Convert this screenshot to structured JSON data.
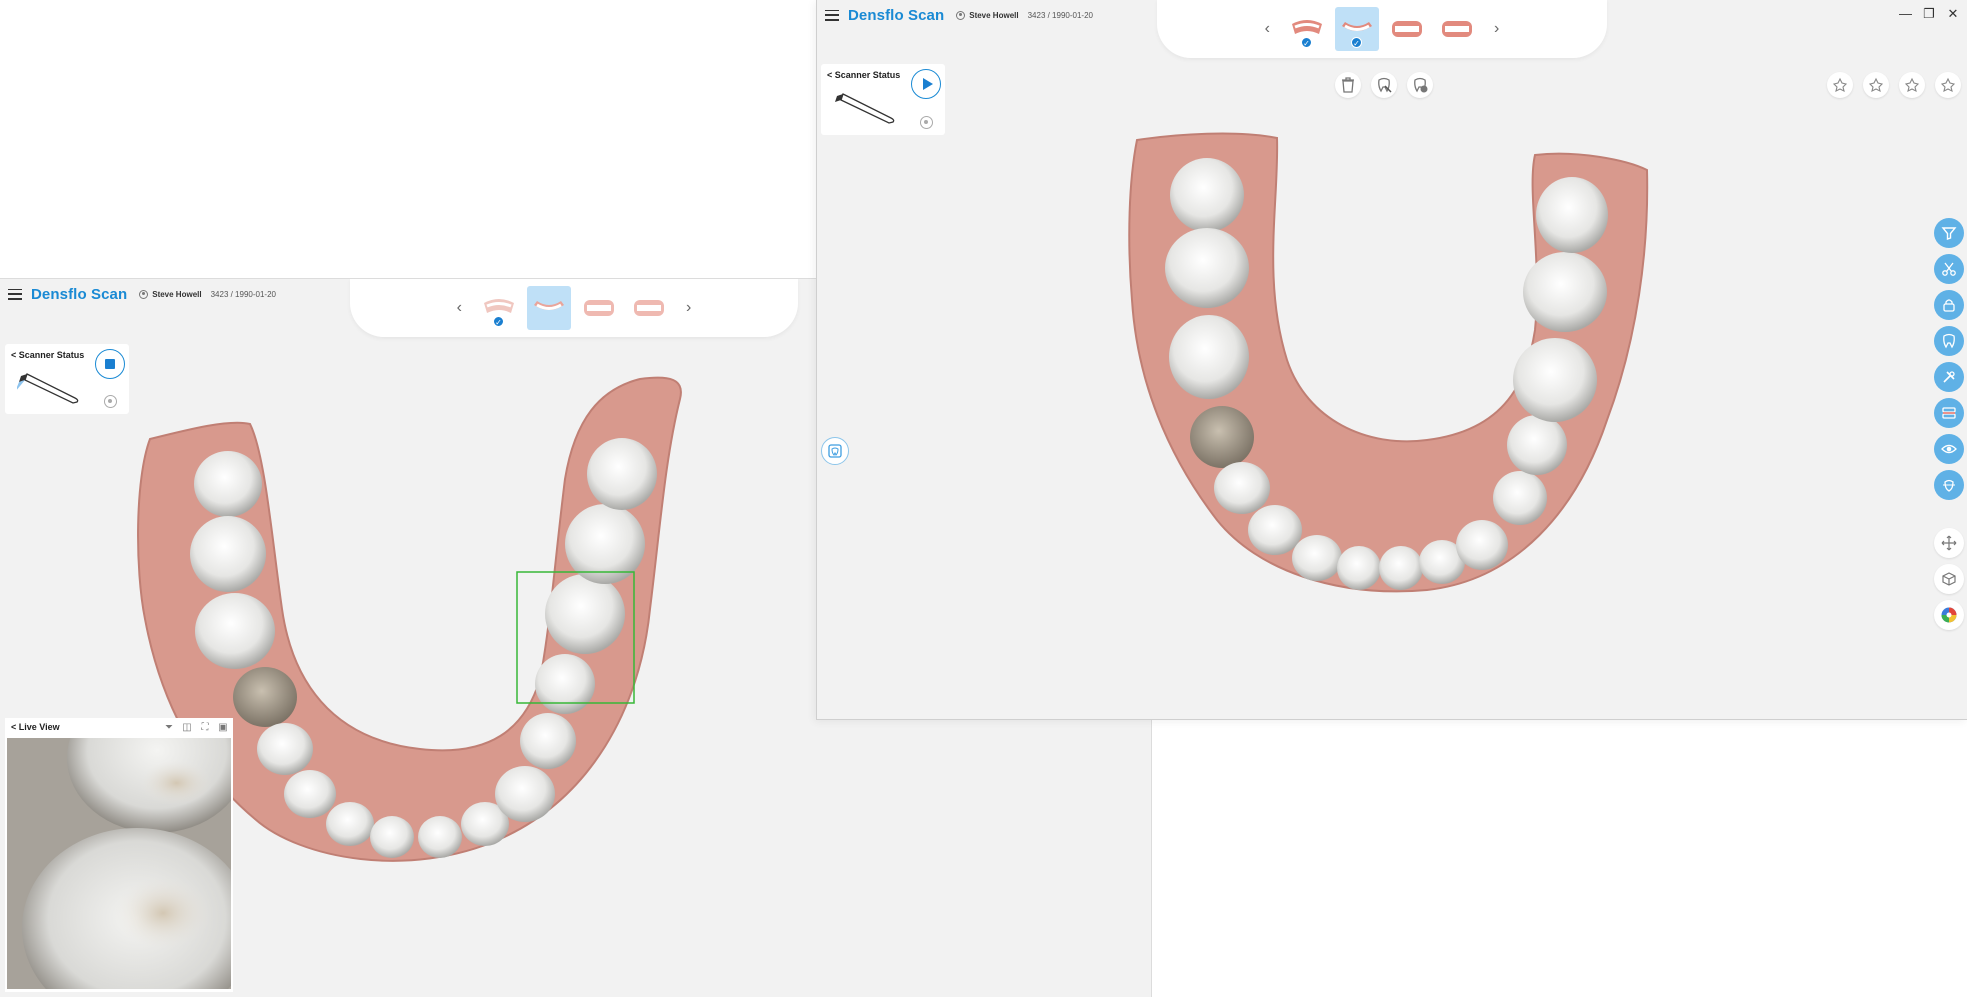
{
  "app": {
    "brand": "Densflo Scan"
  },
  "patient": {
    "name": "Steve Howell",
    "info": "3423 / 1990-01-20"
  },
  "scanner": {
    "title": "< Scanner Status"
  },
  "liveview": {
    "title": "< Live View"
  },
  "icons": {
    "menu": "hamburger-icon",
    "patient": "user-icon",
    "prev": "chevron-left-icon",
    "next": "chevron-right-icon",
    "stop": "stop-icon",
    "play": "play-icon",
    "settings": "gear-icon",
    "delete": "trash-icon",
    "filter": "filter-icon",
    "cut": "scissors-icon",
    "lock": "lock-icon",
    "tooth": "tooth-icon",
    "tools": "wrench-icon",
    "margin": "margin-icon",
    "eye": "eye-icon",
    "bite": "bite-icon",
    "move": "move-icon",
    "cube": "cube-icon",
    "color": "palette-icon"
  },
  "colors": {
    "brand": "#1a8ad4",
    "accent_blue": "#1a7fd0",
    "tool_blue": "#5fb1e6",
    "gum": "#d99a8f",
    "tooth": "#eeeeec",
    "roi_box": "#37b837",
    "background": "#f2f2f2"
  },
  "back_window": {
    "steps": [
      {
        "name": "upper-jaw",
        "selected": false,
        "checked": true
      },
      {
        "name": "lower-jaw",
        "selected": true,
        "checked": false
      },
      {
        "name": "bite-left",
        "selected": false,
        "checked": false
      },
      {
        "name": "bite-right",
        "selected": false,
        "checked": false
      }
    ],
    "scan_state": "scanning"
  },
  "front_window": {
    "steps": [
      {
        "name": "upper-jaw",
        "selected": false,
        "checked": true
      },
      {
        "name": "lower-jaw",
        "selected": true,
        "checked": true
      },
      {
        "name": "bite-left",
        "selected": false,
        "checked": false
      },
      {
        "name": "bite-right",
        "selected": false,
        "checked": false
      }
    ],
    "scan_state": "paused"
  }
}
